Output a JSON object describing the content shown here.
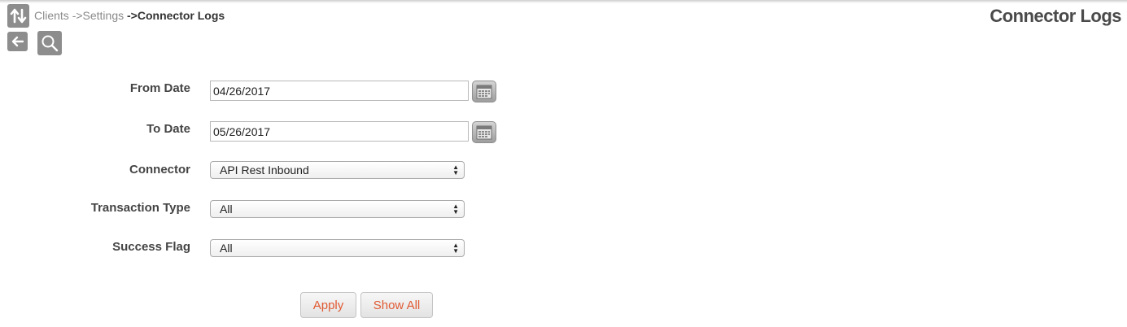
{
  "header": {
    "breadcrumb": {
      "clients": "Clients",
      "sep1": "->",
      "settings": "Settings",
      "sep2": "->",
      "current": "Connector Logs"
    },
    "title": "Connector Logs",
    "icons": [
      "sort-toggle-icon",
      "back-arrow-icon",
      "search-icon"
    ]
  },
  "form": {
    "from_date": {
      "label": "From Date",
      "value": "04/26/2017"
    },
    "to_date": {
      "label": "To Date",
      "value": "05/26/2017"
    },
    "connector": {
      "label": "Connector",
      "selected": "API Rest Inbound"
    },
    "transaction_type": {
      "label": "Transaction Type",
      "selected": "All"
    },
    "success_flag": {
      "label": "Success Flag",
      "selected": "All"
    },
    "calendar_icon": "calendar-icon"
  },
  "actions": {
    "apply_label": "Apply",
    "show_all_label": "Show All"
  },
  "colors": {
    "icon_bg": "#8d8d8d",
    "button_text": "#e05a33",
    "label_text": "#444444"
  }
}
